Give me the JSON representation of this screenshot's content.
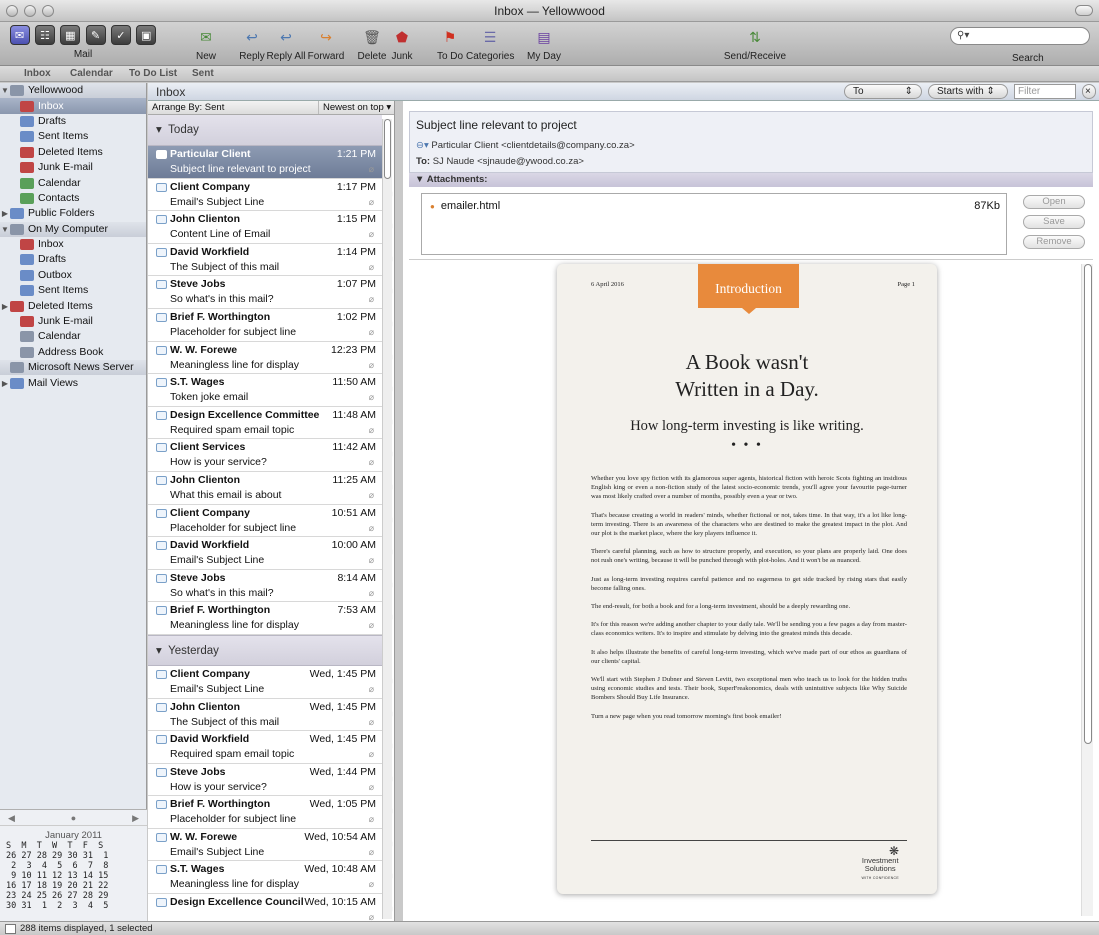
{
  "window": {
    "title": "Inbox — Yellowwood"
  },
  "toolbar": {
    "mail_label": "Mail",
    "new_label": "New",
    "reply_label": "Reply",
    "reply_all_label": "Reply All",
    "forward_label": "Forward",
    "delete_label": "Delete",
    "junk_label": "Junk",
    "todo_label": "To Do",
    "categories_label": "Categories",
    "myday_label": "My Day",
    "sendreceive_label": "Send/Receive",
    "search_label": "Search"
  },
  "nav": {
    "inbox": "Inbox",
    "calendar": "Calendar",
    "todo": "To Do List",
    "sent": "Sent"
  },
  "sidebar": {
    "items": [
      {
        "label": "Yellowwood"
      },
      {
        "label": "Inbox"
      },
      {
        "label": "Drafts"
      },
      {
        "label": "Sent Items"
      },
      {
        "label": "Deleted Items"
      },
      {
        "label": "Junk E-mail"
      },
      {
        "label": "Calendar"
      },
      {
        "label": "Contacts"
      },
      {
        "label": "Public Folders"
      },
      {
        "label": "On My Computer"
      },
      {
        "label": "Inbox"
      },
      {
        "label": "Drafts"
      },
      {
        "label": "Outbox"
      },
      {
        "label": "Sent Items"
      },
      {
        "label": "Deleted Items"
      },
      {
        "label": "Junk E-mail"
      },
      {
        "label": "Calendar"
      },
      {
        "label": "Address Book"
      },
      {
        "label": "Microsoft News Server"
      },
      {
        "label": "Mail Views"
      }
    ]
  },
  "calendar": {
    "month": "January 2011",
    "weekdays": "S  M  T  W  T  F  S",
    "rows": [
      "26 27 28 29 30 31  1",
      " 2  3  4  5  6  7  8",
      " 9 10 11 12 13 14 15",
      "16 17 18 19 20 21 22",
      "23 24 25 26 27 28 29",
      "30 31  1  2  3  4  5"
    ]
  },
  "header": {
    "title": "Inbox",
    "filter_field": "To",
    "filter_mode": "Starts with",
    "filter_placeholder": "Filter"
  },
  "list": {
    "arrange": "Arrange By: Sent",
    "order": "Newest on top",
    "today_label": "Today",
    "yesterday_label": "Yesterday",
    "today": [
      {
        "from": "Particular Client",
        "time": "1:21 PM",
        "subject": "Subject line relevant to project"
      },
      {
        "from": "Client Company",
        "time": "1:17 PM",
        "subject": "Email's Subject Line"
      },
      {
        "from": "John Clienton",
        "time": "1:15 PM",
        "subject": "Content Line of Email"
      },
      {
        "from": "David Workfield",
        "time": "1:14 PM",
        "subject": "The Subject of this mail"
      },
      {
        "from": "Steve Jobs",
        "time": "1:07 PM",
        "subject": "So what's in this mail?"
      },
      {
        "from": "Brief F. Worthington",
        "time": "1:02 PM",
        "subject": "Placeholder for subject line"
      },
      {
        "from": "W. W. Forewe",
        "time": "12:23 PM",
        "subject": "Meaningless line for display"
      },
      {
        "from": "S.T. Wages",
        "time": "11:50 AM",
        "subject": "Token joke email"
      },
      {
        "from": "Design Excellence Committee",
        "time": "11:48 AM",
        "subject": "Required spam email topic"
      },
      {
        "from": "Client Services",
        "time": "11:42 AM",
        "subject": "How is your service?"
      },
      {
        "from": "John Clienton",
        "time": "11:25 AM",
        "subject": "What this email is about"
      },
      {
        "from": "Client Company",
        "time": "10:51 AM",
        "subject": "Placeholder for subject line"
      },
      {
        "from": "David Workfield",
        "time": "10:00 AM",
        "subject": "Email's Subject Line"
      },
      {
        "from": "Steve Jobs",
        "time": "8:14 AM",
        "subject": "So what's in this mail?"
      },
      {
        "from": "Brief F. Worthington",
        "time": "7:53 AM",
        "subject": "Meaningless line for display"
      }
    ],
    "yesterday": [
      {
        "from": "Client Company",
        "time": "Wed, 1:45 PM",
        "subject": "Email's Subject Line"
      },
      {
        "from": "John Clienton",
        "time": "Wed, 1:45 PM",
        "subject": "The Subject of this mail"
      },
      {
        "from": "David Workfield",
        "time": "Wed, 1:45 PM",
        "subject": "Required spam email topic"
      },
      {
        "from": "Steve Jobs",
        "time": "Wed, 1:44 PM",
        "subject": "How is your service?"
      },
      {
        "from": "Brief F. Worthington",
        "time": "Wed, 1:05 PM",
        "subject": "Placeholder for subject line"
      },
      {
        "from": "W. W. Forewe",
        "time": "Wed, 10:54 AM",
        "subject": "Email's Subject Line"
      },
      {
        "from": "S.T. Wages",
        "time": "Wed, 10:48 AM",
        "subject": "Meaningless line for display"
      },
      {
        "from": "Design Excellence Council",
        "time": "Wed, 10:15 AM",
        "subject": ""
      }
    ]
  },
  "message": {
    "subject": "Subject line relevant to project",
    "from": "Particular Client <clientdetails@company.co.za>",
    "to_label": "To:",
    "to": "SJ Naude <sjnaude@ywood.co.za>",
    "attachments_label": "Attachments:",
    "attachment_name": "emailer.html",
    "attachment_size": "87Kb",
    "open_label": "Open",
    "save_label": "Save",
    "remove_label": "Remove"
  },
  "letter": {
    "date": "6 April 2016",
    "page": "Page 1",
    "badge": "Introduction",
    "title_line1": "A Book wasn't",
    "title_line2": "Written in a Day.",
    "subtitle": "How long-term investing is like writing.",
    "dots": "• • •",
    "paragraphs": [
      "Whether you love spy fiction with its glamorous super agents, historical fiction with heroic Scots fighting an insidious English king or even a non-fiction study of the latest socio-economic trends, you'll agree your favourite page-turner was most likely crafted over a number of months, possibly even a year or two.",
      "That's because creating a world in readers' minds, whether fictional or not, takes time. In that way, it's a lot like long-term investing. There is an awareness of the characters who are destined to make the greatest impact in the plot. And our plot is the market place, where the key players influence it.",
      "There's careful planning, such as how to structure properly, and execution, so your plans are properly laid. One does not rush one's writing, because it will be punched through with plot-holes. And it won't be as nuanced.",
      "Just as long-term investing requires careful patience and no eagerness to get side tracked by rising stars that easily become falling ones.",
      " The end-result, for both a book and for a long-term investment, should be a deeply rewarding one.",
      "It's for this reason we're adding another chapter to your daily tale. We'll be sending you a few pages a day from master-class economics writers. It's to inspire and stimulate by delving into the greatest minds this decade.",
      "It also helps illustrate the benefits of careful long-term investing, which we've made part of our ethos as guardians of our clients' capital.",
      "We'll start with Stephen J Dubner and Steven Levitt, two exceptional men who teach us to look for the hidden truths using economic studies and tests. Their book, SuperFreakonomics, deals with unintuitive subjects like Why Suicide Bombers Should Buy Life Insurance.",
      "Turn a new page when you read tomorrow morning's first book emailer!"
    ],
    "logo_line1": "Investment",
    "logo_line2": "Solutions",
    "logo_tag": "WITH CONFIDENCE"
  },
  "status": {
    "text": "288 items displayed, 1 selected"
  }
}
